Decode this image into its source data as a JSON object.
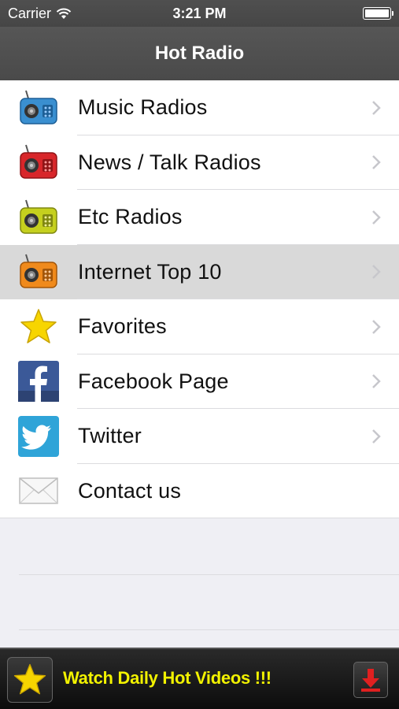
{
  "status_bar": {
    "carrier": "Carrier",
    "time": "3:21 PM"
  },
  "nav": {
    "title": "Hot Radio"
  },
  "menu": [
    {
      "label": "Music Radios",
      "icon": "blue-radio-icon",
      "color": "#3a8fd0",
      "selected": false,
      "chevron": true
    },
    {
      "label": "News / Talk Radios",
      "icon": "red-radio-icon",
      "color": "#d8262a",
      "selected": false,
      "chevron": true
    },
    {
      "label": "Etc Radios",
      "icon": "yellow-radio-icon",
      "color": "#c5d01e",
      "selected": false,
      "chevron": true
    },
    {
      "label": "Internet Top 10",
      "icon": "orange-radio-icon",
      "color": "#f08a1c",
      "selected": true,
      "chevron": true
    },
    {
      "label": "Favorites",
      "icon": "star-icon",
      "color": "#f7d500",
      "selected": false,
      "chevron": true
    },
    {
      "label": "Facebook Page",
      "icon": "facebook-icon",
      "color": "#3b5998",
      "selected": false,
      "chevron": true
    },
    {
      "label": "Twitter",
      "icon": "twitter-icon",
      "color": "#2fa4d8",
      "selected": false,
      "chevron": true
    },
    {
      "label": "Contact us",
      "icon": "envelope-icon",
      "color": "#cfcfcf",
      "selected": false,
      "chevron": false
    }
  ],
  "banner": {
    "text": "Watch Daily Hot Videos !!!",
    "text_color": "#f2f200"
  }
}
